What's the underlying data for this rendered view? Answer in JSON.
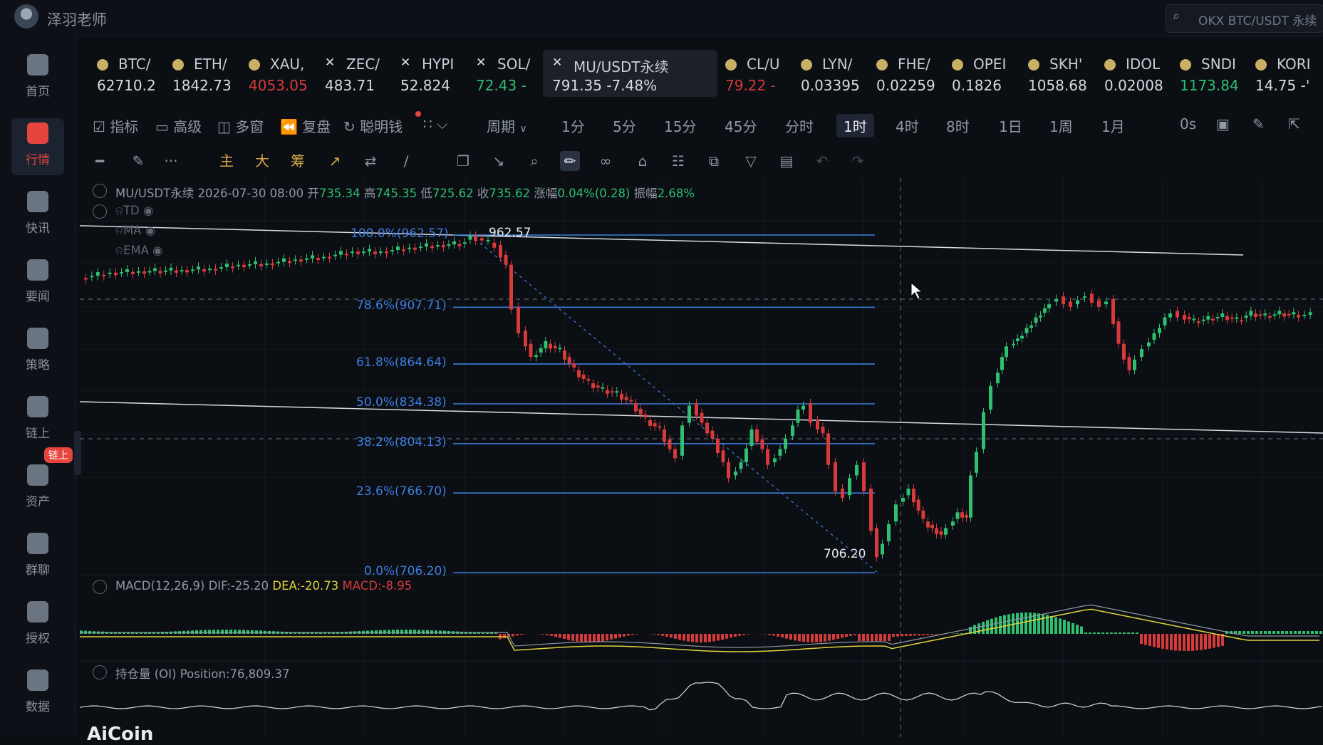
{
  "header": {
    "username": "泽羽老师",
    "search_placeholder": "OKX BTC/USDT 永续"
  },
  "sidebar": {
    "items": [
      {
        "label": "首页",
        "icon": "home-icon"
      },
      {
        "label": "行情",
        "icon": "market-chart-icon",
        "active": true
      },
      {
        "label": "快讯",
        "icon": "news-icon"
      },
      {
        "label": "要闻",
        "icon": "document-icon"
      },
      {
        "label": "策略",
        "icon": "robot-icon"
      },
      {
        "label": "链上",
        "icon": "chain-icon"
      },
      {
        "label": "资产",
        "icon": "wallet-icon"
      },
      {
        "label": "群聊",
        "icon": "chat-icon"
      },
      {
        "label": "授权",
        "icon": "key-icon"
      },
      {
        "label": "数据",
        "icon": "data-icon"
      }
    ],
    "badge": "链上"
  },
  "tickers": [
    {
      "symbol": "BTC/",
      "price": "62710.2",
      "color": "white",
      "icon": "coin"
    },
    {
      "symbol": "ETH/",
      "price": "1842.73",
      "color": "white",
      "icon": "coin"
    },
    {
      "symbol": "XAU,",
      "price": "4053.05",
      "color": "red",
      "icon": "coin"
    },
    {
      "symbol": "ZEC/",
      "price": "483.71",
      "color": "white",
      "icon": "okx"
    },
    {
      "symbol": "HYPI",
      "price": "52.824",
      "color": "white",
      "icon": "okx"
    },
    {
      "symbol": "SOL/",
      "price": "72.43 -",
      "color": "green",
      "icon": "okx"
    },
    {
      "symbol": "MU/USDT永续",
      "price": "791.35  -7.48%",
      "color": "white",
      "icon": "okx",
      "active": true
    },
    {
      "symbol": "CL/U",
      "price": "79.22 -",
      "color": "red",
      "icon": "coin"
    },
    {
      "symbol": "LYN/",
      "price": "0.03395",
      "color": "white",
      "icon": "coin"
    },
    {
      "symbol": "FHE/",
      "price": "0.02259",
      "color": "white",
      "icon": "coin"
    },
    {
      "symbol": "OPEI",
      "price": "0.1826",
      "color": "white",
      "icon": "coin"
    },
    {
      "symbol": "SKH'",
      "price": "1058.68",
      "color": "white",
      "icon": "coin"
    },
    {
      "symbol": "IDOL",
      "price": "0.02008",
      "color": "white",
      "icon": "coin"
    },
    {
      "symbol": "SNDI",
      "price": "1173.84",
      "color": "green",
      "icon": "coin"
    },
    {
      "symbol": "KORI",
      "price": "14.75 -'",
      "color": "white",
      "icon": "coin"
    }
  ],
  "toolbar": {
    "indicator": "指标",
    "advanced": "高级",
    "multi_window": "多窗",
    "replay": "复盘",
    "smart_money": "聪明钱",
    "period": "周期",
    "intervals": [
      "1分",
      "5分",
      "15分",
      "45分",
      "分时",
      "1时",
      "4时",
      "8时",
      "1日",
      "1周",
      "1月"
    ],
    "selected_interval": "1时",
    "refresh": "0s"
  },
  "drawing_tools": {
    "main": "主",
    "big": "大",
    "chips": "筹",
    "more": "···"
  },
  "ohlc": {
    "symbol": "MU/USDT永续",
    "time": "2026-07-30 08:00",
    "open_label": "开",
    "open": "735.34",
    "high_label": "高",
    "high": "745.35",
    "low_label": "低",
    "low": "725.62",
    "close_label": "收",
    "close": "735.62",
    "change_label": "涨幅",
    "change": "0.04%(0.28)",
    "amp_label": "振幅",
    "amp": "2.68%"
  },
  "overlays": [
    "TD",
    "MA",
    "EMA"
  ],
  "fib": {
    "levels": [
      {
        "label": "100.0%(962.57)",
        "value": 962.57
      },
      {
        "label": "78.6%(907.71)",
        "value": 907.71
      },
      {
        "label": "61.8%(864.64)",
        "value": 864.64
      },
      {
        "label": "50.0%(834.38)",
        "value": 834.38
      },
      {
        "label": "38.2%(804.13)",
        "value": 804.13
      },
      {
        "label": "23.6%(766.70)",
        "value": 766.7
      },
      {
        "label": "0.0%(706.20)",
        "value": 706.2
      }
    ],
    "high_tag": "962.57",
    "low_tag": "706.20",
    "color": "#3d7ee0"
  },
  "macd": {
    "title": "MACD(12,26,9)",
    "dif": "DIF:-25.20",
    "dea": "DEA:-20.73",
    "macd": "MACD:-8.95"
  },
  "oi": {
    "title": "持仓量 (OI)",
    "position": "Position:76,809.37"
  },
  "watermark": "AiCoin",
  "colors": {
    "up": "#2fbf71",
    "down": "#d63a3a",
    "fib": "#3d7ee0",
    "dea": "#e0d23c",
    "accent": "#e6453e"
  }
}
